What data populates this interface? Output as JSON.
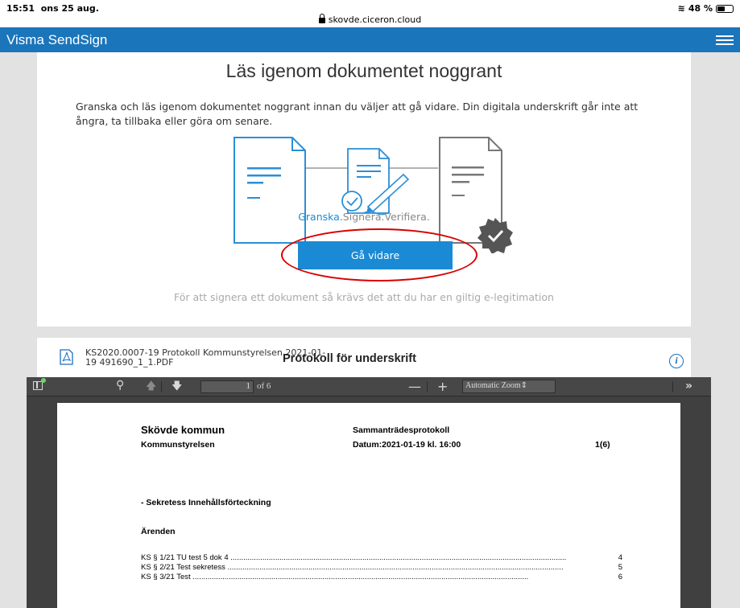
{
  "status_bar": {
    "time": "15:51",
    "date": "ons 25 aug.",
    "url": "skovde.ciceron.cloud",
    "battery": "48 %",
    "battery_level": 0.48
  },
  "app": {
    "brand": "Visma SendSign",
    "accent_color": "#1b75bb",
    "menu_icon": "hamburger-menu-icon"
  },
  "intro": {
    "title": "Läs igenom dokumentet noggrant",
    "description": "Granska och läs igenom dokumentet noggrant innan du väljer att gå vidare. Din digitala underskrift går inte att ångra, ta tillbaka eller göra om senare.",
    "steps": [
      "Granska.",
      "Signera.",
      "Verifiera."
    ],
    "continue_button": "Gå vidare",
    "requirement": "För att signera ett dokument så krävs det att du har en giltig e-legitimation"
  },
  "document": {
    "file_name": "KS2020.0007-19 Protokoll Kommunstyrelsen 2021-01-19 491690_1_1.PDF",
    "title": "Protokoll för underskrift",
    "info_symbol": "i"
  },
  "viewer": {
    "page_number": "1",
    "page_of": "of 6",
    "zoom_out": "—",
    "zoom_in": "+",
    "zoom": "Automatic Zoom",
    "more": "»"
  },
  "pdf_page": {
    "organization": "Skövde kommun",
    "board": "Kommunstyrelsen",
    "protocol": "Sammanträdesprotokoll",
    "date": "Datum:2021-01-19 kl. 16:00",
    "page_count": "1(6)",
    "section": "- Sekretess Innehållsförteckning",
    "heading": "Ärenden",
    "toc": [
      {
        "title": "KS § 1/21 TU test 5 dok 4",
        "page": "4"
      },
      {
        "title": "KS § 2/21 Test sekretess",
        "page": "5"
      },
      {
        "title": "KS § 3/21 Test",
        "page": "6"
      }
    ]
  }
}
